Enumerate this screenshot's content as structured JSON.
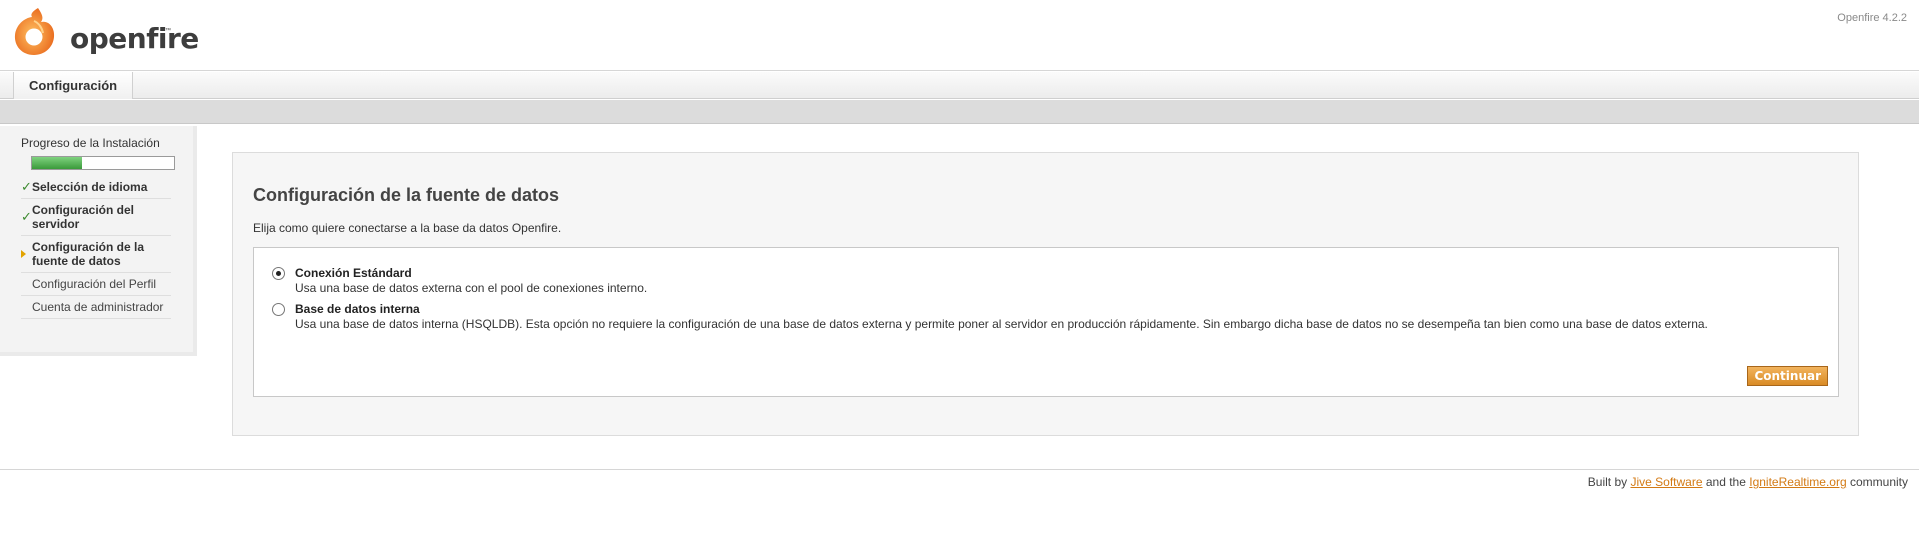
{
  "header": {
    "logo_text": "openfire",
    "logo_tm": "™",
    "version": "Openfire 4.2.2"
  },
  "tabs": [
    {
      "label": "Configuración"
    }
  ],
  "sidebar": {
    "progress_title": "Progreso de la Instalación",
    "progress_fraction": 0.35,
    "steps": [
      {
        "label": "Selección de idioma",
        "status": "done"
      },
      {
        "label": "Configuración del servidor",
        "status": "done"
      },
      {
        "label": "Configuración de la fuente de datos",
        "status": "current"
      },
      {
        "label": "Configuración del Perfil",
        "status": "pending"
      },
      {
        "label": "Cuenta de administrador",
        "status": "pending"
      }
    ]
  },
  "main": {
    "title": "Configuración de la fuente de datos",
    "description": "Elija como quiere conectarse a la base da datos Openfire.",
    "options": [
      {
        "label": "Conexión Estándard",
        "description": "Usa una base de datos externa con el pool de conexiones interno.",
        "checked": true
      },
      {
        "label": "Base de datos interna",
        "description": "Usa una base de datos interna (HSQLDB). Esta opción no requiere la configuración de una base de datos externa y permite poner al servidor en producción rápidamente. Sin embargo dicha base de datos no se desempeña tan bien como una base de datos externa.",
        "checked": false
      }
    ],
    "continue_label": "Continuar"
  },
  "footer": {
    "prefix": "Built by",
    "link1": "Jive Software",
    "middle": "and the",
    "link2": "IgniteRealtime.org",
    "suffix": "community"
  },
  "colors": {
    "accent": "#d98b25",
    "progress": "#3a9a3a",
    "link": "#d37a14"
  }
}
